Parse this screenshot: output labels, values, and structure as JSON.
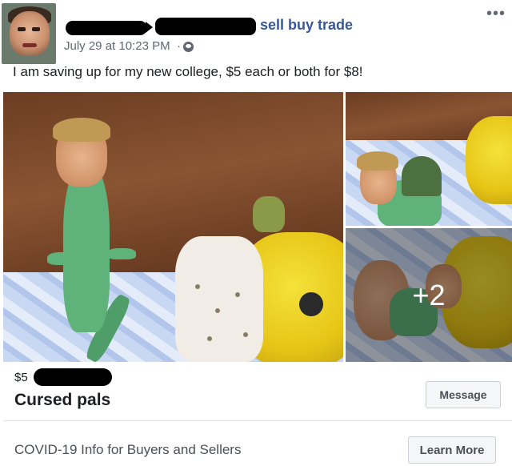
{
  "post": {
    "group_name": "sell buy trade",
    "timestamp": "July 29 at 10:23 PM",
    "separator": "·",
    "privacy_icon": "globe-icon",
    "more_icon": "more-options-icon",
    "more_glyph": "•••",
    "caption": "I am saving up for my new college, $5 each or both for $8!"
  },
  "photos": {
    "extra_count": "+2"
  },
  "listing": {
    "price": "$5",
    "title": "Cursed pals",
    "message_button": "Message"
  },
  "footer": {
    "covid_text": "COVID-19 Info for Buyers and Sellers",
    "learn_more_button": "Learn More"
  },
  "colors": {
    "link_blue": "#385898",
    "text_secondary": "#606770",
    "button_bg": "#f5f6f7"
  }
}
